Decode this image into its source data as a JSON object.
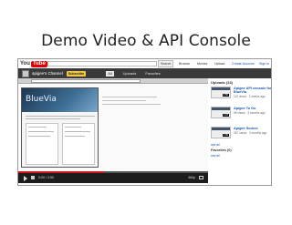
{
  "slide": {
    "title": "Demo Video & API Console"
  },
  "youtube": {
    "logo_you": "You",
    "logo_tube": "Tube",
    "search_button": "Search",
    "nav": [
      "Browse",
      "Movies",
      "Upload"
    ],
    "nav_right": [
      "Create Account",
      "Sign In"
    ]
  },
  "channel": {
    "name": "apigee's Channel",
    "subscribe_label": "Subscribe",
    "tabs": [
      "All",
      "Uploads",
      "Favorites"
    ]
  },
  "video": {
    "title": "BlueVia",
    "time": "0:00 / 2:50",
    "quality": "360p",
    "progress_fraction": 0.45
  },
  "sidebar": {
    "uploads_header": "Uploads (33)",
    "uploads": [
      {
        "title": "Apigee API console for BlueVia",
        "meta": "110 views · 2 weeks ago",
        "duration": "2:50"
      },
      {
        "title": "Apigee To Go",
        "meta": "96 views · 3 months ago",
        "duration": "1:24"
      },
      {
        "title": "Apigee Source",
        "meta": "367 views · 3 months ago",
        "duration": "1:09"
      }
    ],
    "see_all": "see all",
    "favorites_header": "Favorites (0)",
    "favorites_see_all": "see all"
  },
  "colors": {
    "youtube_red": "#cc181e",
    "subscribe_yellow": "#f2c744",
    "channel_bar": "#3a3a3a",
    "link_blue": "#1155aa"
  }
}
